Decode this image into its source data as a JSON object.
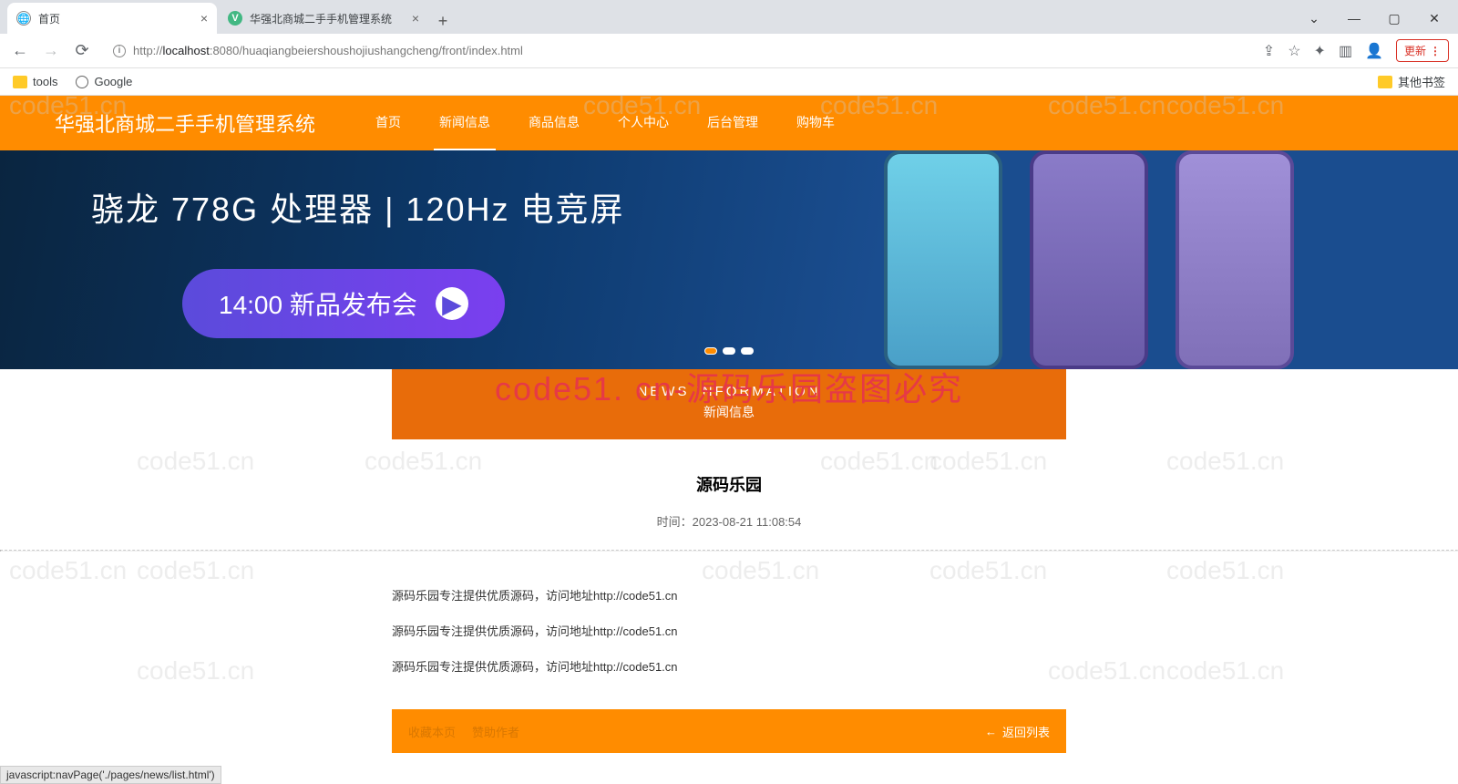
{
  "browser": {
    "tabs": [
      {
        "title": "首页",
        "favicon": "globe"
      },
      {
        "title": "华强北商城二手手机管理系统",
        "favicon": "vue"
      }
    ],
    "url": "http://localhost:8080/huaqiangbeiershoushojiushangcheng/front/index.html",
    "url_host": "localhost",
    "url_port_path": ":8080/huaqiangbeiershoushojiushangcheng/front/index.html",
    "url_prefix": "http://",
    "bookmarks": {
      "left": [
        {
          "label": "tools",
          "type": "folder"
        },
        {
          "label": "Google",
          "type": "globe"
        }
      ],
      "right": {
        "label": "其他书签",
        "type": "folder"
      }
    },
    "update_label": "更新",
    "window_controls": {
      "min": "—",
      "max": "▢",
      "close": "✕",
      "dropdown": "⌄"
    }
  },
  "site": {
    "title": "华强北商城二手手机管理系统",
    "nav": [
      {
        "label": "首页"
      },
      {
        "label": "新闻信息",
        "active": true
      },
      {
        "label": "商品信息"
      },
      {
        "label": "个人中心"
      },
      {
        "label": "后台管理"
      },
      {
        "label": "购物车"
      }
    ]
  },
  "banner": {
    "headline": "骁龙 778G 处理器 | 120Hz 电竞屏",
    "pill_text": "14:00 新品发布会"
  },
  "watermark_main": "code51. cn-源码乐园盗图必究",
  "watermark_bg": "code51.cn",
  "section": {
    "en": "NEWS  INFORMATION",
    "cn": "新闻信息"
  },
  "article": {
    "title": "源码乐园",
    "time_label": "时间：",
    "time_value": "2023-08-21 11:08:54",
    "lines": [
      "源码乐园专注提供优质源码，访问地址http://code51.cn",
      "源码乐园专注提供优质源码，访问地址http://code51.cn",
      "源码乐园专注提供优质源码，访问地址http://code51.cn"
    ]
  },
  "actions": {
    "left": [
      "收藏本页",
      "赞助作者"
    ],
    "right": "返回列表",
    "arrow": "←"
  },
  "status_bar": "javascript:navPage('./pages/news/list.html')"
}
